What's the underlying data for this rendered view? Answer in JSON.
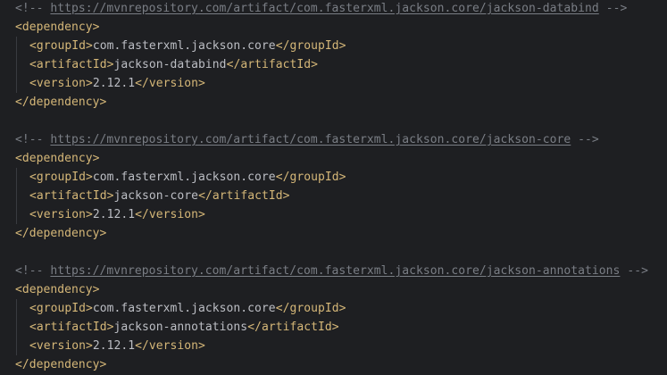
{
  "colors": {
    "background": "#1e1f22",
    "comment": "#7a7e85",
    "tag": "#d5b778",
    "text": "#bcbec4",
    "indent_guide": "#393b40"
  },
  "blocks": [
    {
      "comment_open": "<!--",
      "url": "https://mvnrepository.com/artifact/com.fasterxml.jackson.core/jackson-databind",
      "comment_close": "-->",
      "dependency_open": "<dependency>",
      "groupId_open": "<groupId>",
      "groupId": "com.fasterxml.jackson.core",
      "groupId_close": "</groupId>",
      "artifactId_open": "<artifactId>",
      "artifactId": "jackson-databind",
      "artifactId_close": "</artifactId>",
      "version_open": "<version>",
      "version": "2.12.1",
      "version_close": "</version>",
      "dependency_close": "</dependency>"
    },
    {
      "comment_open": "<!--",
      "url": "https://mvnrepository.com/artifact/com.fasterxml.jackson.core/jackson-core",
      "comment_close": "-->",
      "dependency_open": "<dependency>",
      "groupId_open": "<groupId>",
      "groupId": "com.fasterxml.jackson.core",
      "groupId_close": "</groupId>",
      "artifactId_open": "<artifactId>",
      "artifactId": "jackson-core",
      "artifactId_close": "</artifactId>",
      "version_open": "<version>",
      "version": "2.12.1",
      "version_close": "</version>",
      "dependency_close": "</dependency>"
    },
    {
      "comment_open": "<!--",
      "url": "https://mvnrepository.com/artifact/com.fasterxml.jackson.core/jackson-annotations",
      "comment_close": "-->",
      "dependency_open": "<dependency>",
      "groupId_open": "<groupId>",
      "groupId": "com.fasterxml.jackson.core",
      "groupId_close": "</groupId>",
      "artifactId_open": "<artifactId>",
      "artifactId": "jackson-annotations",
      "artifactId_close": "</artifactId>",
      "version_open": "<version>",
      "version": "2.12.1",
      "version_close": "</version>",
      "dependency_close": "</dependency>"
    }
  ]
}
